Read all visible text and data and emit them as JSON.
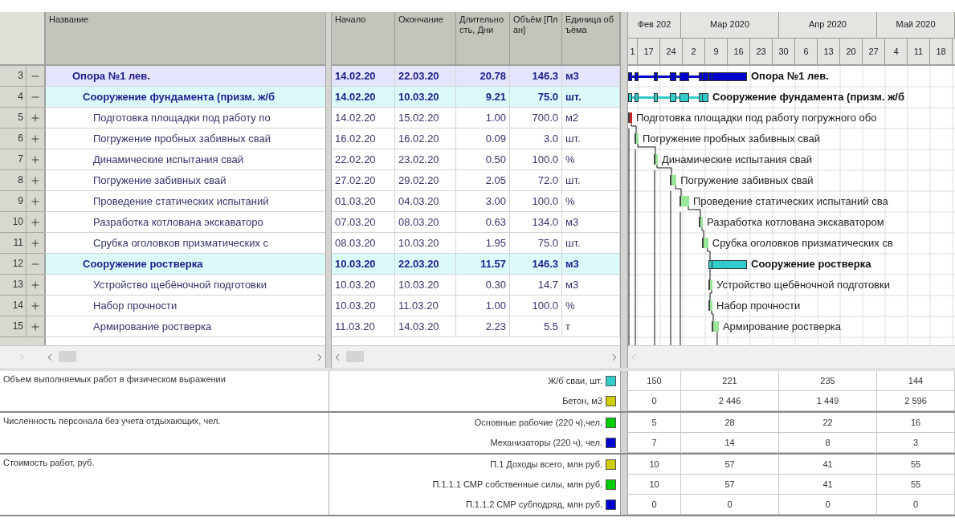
{
  "columns": [
    "Название",
    "Начало",
    "Окончание",
    "Длительность, Дни",
    "Объём [План]",
    "Единица объёма"
  ],
  "timeline": {
    "months": [
      "Фев 202",
      "Мар 2020",
      "Апр 2020",
      "Май 2020"
    ],
    "weeks": [
      "1",
      "17",
      "24",
      "2",
      "9",
      "16",
      "23",
      "30",
      "6",
      "13",
      "20",
      "27",
      "4",
      "11",
      "18"
    ]
  },
  "tasks": [
    {
      "number": "3",
      "kind": "phase",
      "expanded": true,
      "name": "Опора №1 лев.",
      "start": "14.02.20",
      "end": "22.03.20",
      "duration": "20.78",
      "volume": "146.3",
      "unit": "м3",
      "color": "#0000cc",
      "bar_label": "Опора №1 лев.",
      "children": [
        {
          "number": "4",
          "kind": "summary",
          "expanded": true,
          "name": "Сооружение фундамента (призм. ж/б",
          "start": "14.02.20",
          "end": "10.03.20",
          "duration": "9.21",
          "volume": "75.0",
          "unit": "шт.",
          "color": "#33cccc",
          "bar_label": "Сооружение фундамента (призм. ж/б",
          "children": [
            {
              "number": "5",
              "kind": "task",
              "expanded": false,
              "name": "Подготовка площадки под работу по",
              "start": "14.02.20",
              "end": "15.02.20",
              "duration": "1.00",
              "volume": "700.0",
              "unit": "м2",
              "color": "#cc2222",
              "bar_label": "Подготовка площадки под работу погружного обо"
            },
            {
              "number": "6",
              "kind": "task",
              "expanded": false,
              "name": "Погружение пробных забивных свай",
              "start": "16.02.20",
              "end": "16.02.20",
              "duration": "0.09",
              "volume": "3.0",
              "unit": "шт.",
              "color": "#99e699",
              "bar_label": "Погружение пробных забивных свай"
            },
            {
              "number": "7",
              "kind": "task",
              "expanded": false,
              "name": "Динамические испытания свай",
              "start": "22.02.20",
              "end": "23.02.20",
              "duration": "0.50",
              "volume": "100.0",
              "unit": "%",
              "color": "#99e699",
              "bar_label": "Динамические испытания свай"
            },
            {
              "number": "8",
              "kind": "task",
              "expanded": false,
              "name": "Погружение забивных свай",
              "start": "27.02.20",
              "end": "29.02.20",
              "duration": "2.05",
              "volume": "72.0",
              "unit": "шт.",
              "color": "#99e699",
              "bar_label": "Погружение забивных свай"
            },
            {
              "number": "9",
              "kind": "task",
              "expanded": false,
              "name": "Проведение статических испытаний",
              "start": "01.03.20",
              "end": "04.03.20",
              "duration": "3.00",
              "volume": "100.0",
              "unit": "%",
              "color": "#99e699",
              "bar_label": "Проведение статических испытаний сва"
            },
            {
              "number": "10",
              "kind": "task",
              "expanded": false,
              "name": "Разработка котлована экскаваторо",
              "start": "07.03.20",
              "end": "08.03.20",
              "duration": "0.63",
              "volume": "134.0",
              "unit": "м3",
              "color": "#99e699",
              "bar_label": "Разработка котлована экскаватором"
            },
            {
              "number": "11",
              "kind": "task",
              "expanded": false,
              "name": "Срубка оголовков призматических с",
              "start": "08.03.20",
              "end": "10.03.20",
              "duration": "1.95",
              "volume": "75.0",
              "unit": "шт.",
              "color": "#99e699",
              "bar_label": "Срубка оголовков призматических св"
            }
          ]
        },
        {
          "number": "12",
          "kind": "summary",
          "expanded": true,
          "name": "Сооружение ростверка",
          "start": "10.03.20",
          "end": "22.03.20",
          "duration": "11.57",
          "volume": "146.3",
          "unit": "м3",
          "color": "#33cccc",
          "bar_label": "Сооружение ростверка",
          "children": [
            {
              "number": "13",
              "kind": "task",
              "expanded": false,
              "name": "Устройство щебёночной подготовки",
              "start": "10.03.20",
              "end": "10.03.20",
              "duration": "0.30",
              "volume": "14.7",
              "unit": "м3",
              "color": "#99e699",
              "bar_label": "Устройство щебёночной подготовки"
            },
            {
              "number": "14",
              "kind": "task",
              "expanded": false,
              "name": "Набор прочности",
              "start": "10.03.20",
              "end": "11.03.20",
              "duration": "1.00",
              "volume": "100.0",
              "unit": "%",
              "color": "#99e699",
              "bar_label": "Набор прочности"
            },
            {
              "number": "15",
              "kind": "task",
              "expanded": false,
              "name": "Армирование ростверка",
              "start": "11.03.20",
              "end": "14.03.20",
              "duration": "2.23",
              "volume": "5.5",
              "unit": "т",
              "color": "#99e699",
              "bar_label": "Армирование ростверка"
            }
          ]
        }
      ]
    }
  ],
  "resource_panel": [
    {
      "title": "Объем выполняемых работ в физическом выражении",
      "rows": [
        {
          "label": "Ж/б сваи, шт.",
          "color": "#33cccc",
          "values": [
            "150",
            "221",
            "235",
            "144"
          ]
        },
        {
          "label": "Бетон, м3",
          "color": "#cccc00",
          "values": [
            "0",
            "2 446",
            "1 449",
            "2 596"
          ]
        }
      ]
    },
    {
      "title": "Численность персонала без учета отдыхающих, чел.",
      "rows": [
        {
          "label": "Основные рабочие (220 ч),чел.",
          "color": "#00cc00",
          "values": [
            "5",
            "28",
            "22",
            "16"
          ]
        },
        {
          "label": "Механизаторы (220 ч), чел.",
          "color": "#0000cc",
          "values": [
            "7",
            "14",
            "8",
            "3"
          ]
        }
      ]
    },
    {
      "title": "Стоимость работ, руб.",
      "rows": [
        {
          "label": "П.1 Доходы всего, млн руб.",
          "color": "#cccc00",
          "values": [
            "10",
            "57",
            "41",
            "55"
          ]
        },
        {
          "label": "П.1.1.1 СМР собственные силы, млн руб.",
          "color": "#00cc00",
          "values": [
            "10",
            "57",
            "41",
            "55"
          ]
        },
        {
          "label": "П.1.1.2 СМР субподряд, млн руб.",
          "color": "#0000cc",
          "values": [
            "0",
            "0",
            "0",
            "0"
          ]
        }
      ]
    }
  ]
}
